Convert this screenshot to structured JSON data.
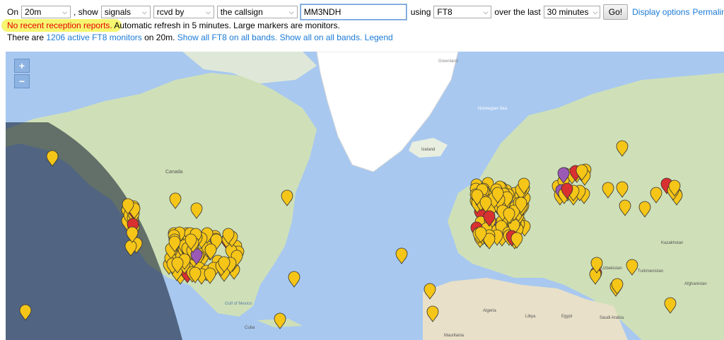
{
  "controls": {
    "on_label": "On",
    "band": "20m",
    "show_label": ", show",
    "show": "signals",
    "direction": "rcvd by",
    "target_type": "the callsign",
    "callsign": "MM3NDH",
    "using_label": "using",
    "mode": "FT8",
    "over_label": "over the last",
    "period": "30 minutes",
    "go_label": "Go!",
    "display_options": "Display options",
    "permalink": "Permalink"
  },
  "status": {
    "warning": "No recent reception reports.",
    "info": " Automatic refresh in 5 minutes. Large markers are monitors."
  },
  "monitors": {
    "prefix": "There are ",
    "link": "1206 active FT8 monitors",
    "suffix": " on 20m. ",
    "show_ft8_all": "Show all FT8 on all bands.",
    "show_all": "Show all on all bands.",
    "legend": "Legend"
  },
  "map": {
    "zoom_in": "+",
    "zoom_out": "−",
    "labels": {
      "canada": "Canada",
      "greenland": "Greenland",
      "iceland": "Iceland",
      "norwegian_sea": "Norwegian Sea",
      "kazakhstan": "Kazakhstan",
      "turkmenistan": "Turkmenistan",
      "afghanistan": "Afghanistan",
      "uzbekistan": "Uzbekistan",
      "algeria": "Algeria",
      "libya": "Libya",
      "egypt": "Egypt",
      "saudi_arabia": "Saudi Arabia",
      "cuba": "Cuba",
      "mauritania": "Mauritania",
      "gulf_of_mexico": "Gulf of Mexico"
    },
    "colors": {
      "ocean": "#a8c8f0",
      "land": "#cfe0b8",
      "ice": "#ffffff",
      "desert": "#e8e0c8",
      "marker": "#f5c518",
      "marker_stroke": "#333333"
    }
  }
}
